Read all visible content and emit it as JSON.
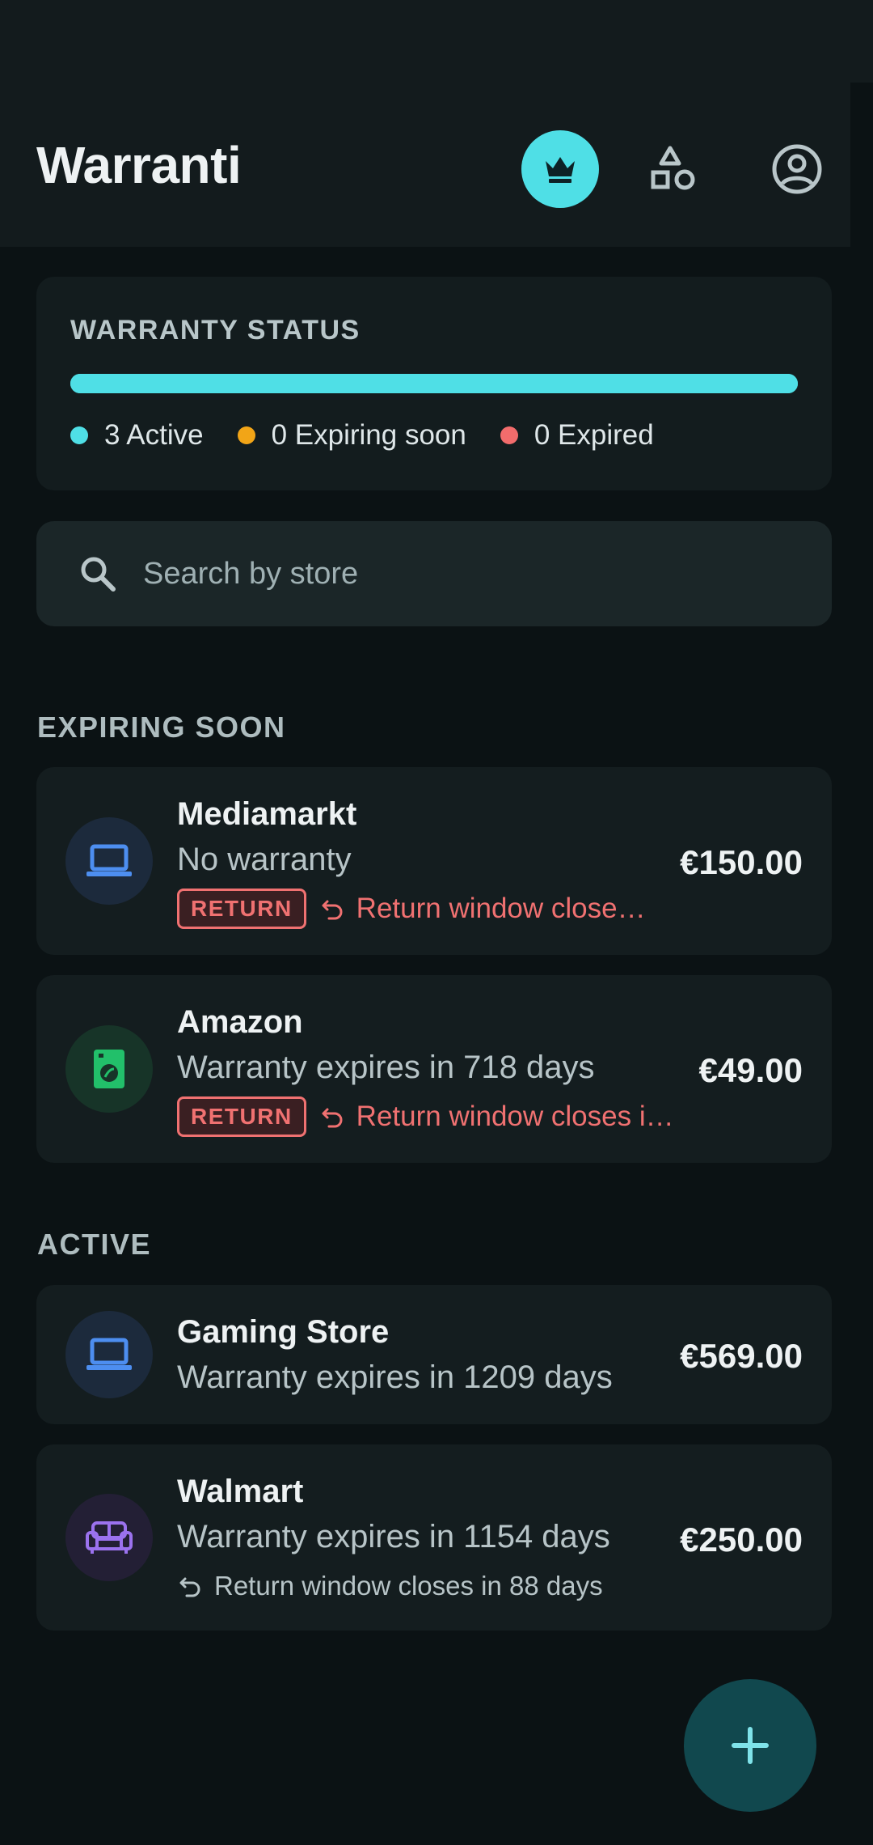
{
  "app": {
    "title": "Warranti"
  },
  "header": {
    "premium_icon": "crown-icon",
    "categories_icon": "shapes-icon",
    "profile_icon": "account-circle-icon"
  },
  "status": {
    "title": "WARRANTY STATUS",
    "active_fraction": 1.0,
    "legend": [
      {
        "label": "3 Active",
        "color": "#4fdfe6"
      },
      {
        "label": "0 Expiring soon",
        "color": "#f2a517"
      },
      {
        "label": "0 Expired",
        "color": "#f26c6c"
      }
    ]
  },
  "search": {
    "placeholder": "Search by store",
    "icon": "search-icon"
  },
  "sections": {
    "expiring": "EXPIRING SOON",
    "active": "ACTIVE"
  },
  "items": [
    {
      "store": "Mediamarkt",
      "subtitle": "No warranty",
      "price": "€150.00",
      "badge": "RETURN",
      "return_text": "Return window close…",
      "icon": "laptop-icon"
    },
    {
      "store": "Amazon",
      "subtitle": "Warranty expires in 718 days",
      "price": "€49.00",
      "badge": "RETURN",
      "return_text": "Return window closes i…",
      "icon": "washing-machine-icon"
    },
    {
      "store": "Gaming Store",
      "subtitle": "Warranty expires in 1209 days",
      "price": "€569.00",
      "icon": "laptop-icon"
    },
    {
      "store": "Walmart",
      "subtitle": "Warranty expires in 1154 days",
      "price": "€250.00",
      "return_text": "Return window closes in 88 days",
      "icon": "sofa-icon"
    }
  ],
  "fab": {
    "icon": "plus-icon"
  },
  "colors": {
    "accent": "#4fdfe6",
    "warning": "#f2a517",
    "danger": "#f26c6c"
  }
}
